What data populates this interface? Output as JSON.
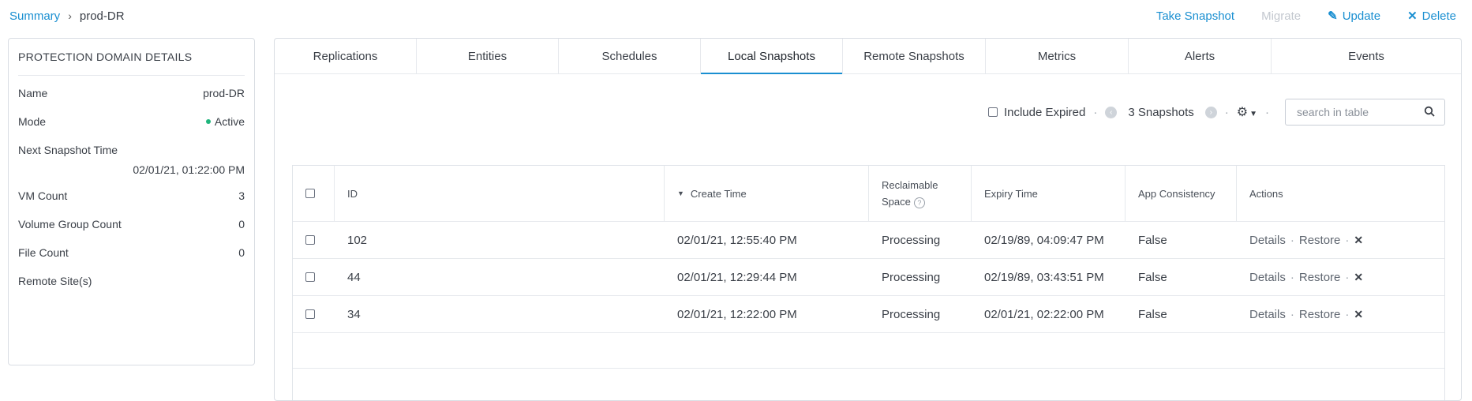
{
  "breadcrumb": {
    "root": "Summary",
    "separator": "›",
    "current": "prod-DR"
  },
  "top_actions": {
    "take_snapshot": "Take Snapshot",
    "migrate": "Migrate",
    "update": "Update",
    "delete": "Delete"
  },
  "details": {
    "title": "PROTECTION DOMAIN DETAILS",
    "rows": [
      {
        "label": "Name",
        "value": "prod-DR"
      },
      {
        "label": "Mode",
        "value": "Active"
      },
      {
        "label": "Next Snapshot Time",
        "value": "02/01/21, 01:22:00 PM"
      },
      {
        "label": "VM Count",
        "value": "3"
      },
      {
        "label": "Volume Group Count",
        "value": "0"
      },
      {
        "label": "File Count",
        "value": "0"
      },
      {
        "label": "Remote Site(s)",
        "value": ""
      }
    ]
  },
  "tabs": [
    {
      "label": "Replications"
    },
    {
      "label": "Entities"
    },
    {
      "label": "Schedules"
    },
    {
      "label": "Local Snapshots",
      "active": true
    },
    {
      "label": "Remote Snapshots"
    },
    {
      "label": "Metrics"
    },
    {
      "label": "Alerts"
    },
    {
      "label": "Events"
    }
  ],
  "toolbar": {
    "include_expired": "Include Expired",
    "count": "3 Snapshots",
    "search_placeholder": "search in table"
  },
  "table": {
    "headers": {
      "id": "ID",
      "create_time": "Create Time",
      "reclaimable_1": "Reclaimable",
      "reclaimable_2": "Space",
      "expiry": "Expiry Time",
      "app_consistency": "App Consistency",
      "actions": "Actions"
    },
    "rows": [
      {
        "id": "102",
        "create_time": "02/01/21, 12:55:40 PM",
        "reclaimable": "Processing",
        "expiry": "02/19/89, 04:09:47 PM",
        "app_consistency": "False"
      },
      {
        "id": "44",
        "create_time": "02/01/21, 12:29:44 PM",
        "reclaimable": "Processing",
        "expiry": "02/19/89, 03:43:51 PM",
        "app_consistency": "False"
      },
      {
        "id": "34",
        "create_time": "02/01/21, 12:22:00 PM",
        "reclaimable": "Processing",
        "expiry": "02/01/21, 02:22:00 PM",
        "app_consistency": "False"
      }
    ],
    "action_labels": {
      "details": "Details",
      "restore": "Restore"
    }
  },
  "colors": {
    "accent": "#1a8fd1",
    "active_dot": "#1fb57c",
    "disabled": "#c3c8cf"
  }
}
